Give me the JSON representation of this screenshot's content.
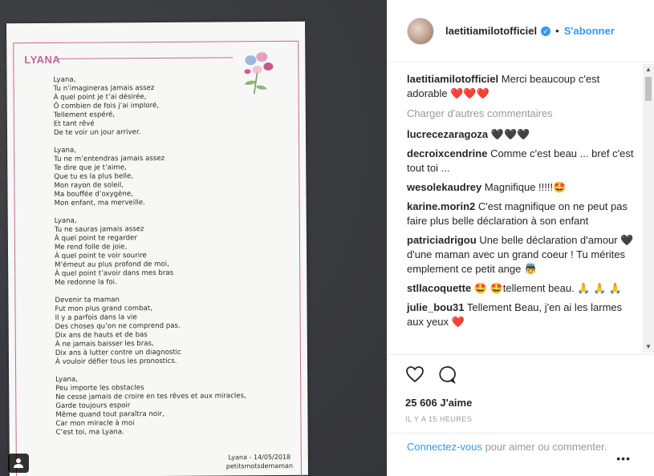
{
  "header": {
    "username": "laetitiamilotofficiel",
    "separator": "•",
    "follow_label": "S'abonner"
  },
  "card": {
    "title": "LYANA",
    "stanzas": [
      "Lyana,\nTu n’imagineras jamais assez\nÀ quel point je t’ai désirée,\nÔ combien de fois j’ai imploré,\nTellement espéré,\nEt tant rêvé\nDe te voir un jour arriver.",
      "Lyana,\nTu ne m’entendras jamais assez\nTe dire que je t’aime,\nQue tu es la plus belle,\nMon rayon de soleil,\nMa bouffée d’oxygène,\nMon enfant, ma merveille.",
      "Lyana,\nTu ne sauras jamais assez\nÀ quel point te regarder\nMe rend folle de joie,\nÀ quel point te voir sourire\nM’émeut au plus profond de moi,\nÀ quel point t’avoir dans mes bras\nMe redonne la foi.",
      "Devenir ta maman\nFut mon plus grand combat,\nIl y a parfois dans la vie\nDes choses qu’on ne comprend pas.\nDix ans de hauts et de bas\nÀ ne jamais baisser les bras,\nDix ans à lutter contre un diagnostic\nÀ vouloir défier tous les pronostics.",
      "Lyana,\nPeu importe les obstacles\nNe cesse jamais de croire en tes rêves et aux miracles,\nGarde toujours espoir\nMême quand tout paraîtra noir,\nCar mon miracle à moi\nC’est toi, ma Lyana."
    ],
    "signature_date": "Lyana - 14/05/2018",
    "signature_site": "petitsmotsdemaman"
  },
  "comments": {
    "caption_user": "laetitiamilotofficiel",
    "caption_text": "Merci beaucoup c'est adorable",
    "caption_emoji": "❤️❤️❤️",
    "load_more": "Charger d'autres commentaires",
    "items": [
      {
        "user": "lucrecezaragoza",
        "text": "🖤🖤🖤"
      },
      {
        "user": "decroixcendrine",
        "text": "Comme c'est beau ... bref c'est tout toi ..."
      },
      {
        "user": "wesolekaudrey",
        "text": "Magnifique !!!!!🤩"
      },
      {
        "user": "karine.morin2",
        "text": "C'est magnifique on ne peut pas faire plus belle déclaration à son enfant"
      },
      {
        "user": "patriciadrigou",
        "text": "Une belle déclaration d'amour 🖤 d'une maman avec un grand coeur ! Tu mérites emplement ce petit ange 👼"
      },
      {
        "user": "stllacoquette",
        "text": "🤩 🤩tellement beau. 🙏 🙏 🙏"
      },
      {
        "user": "julie_bou31",
        "text": "Tellement Beau, j'en ai les larmes aux yeux ❤️"
      }
    ]
  },
  "actions": {
    "likes": "25 606 J'aime",
    "time": "IL Y A 15 HEURES"
  },
  "add_comment": {
    "link": "Connectez-vous",
    "text": " pour aimer ou commenter.",
    "more": "•••"
  }
}
